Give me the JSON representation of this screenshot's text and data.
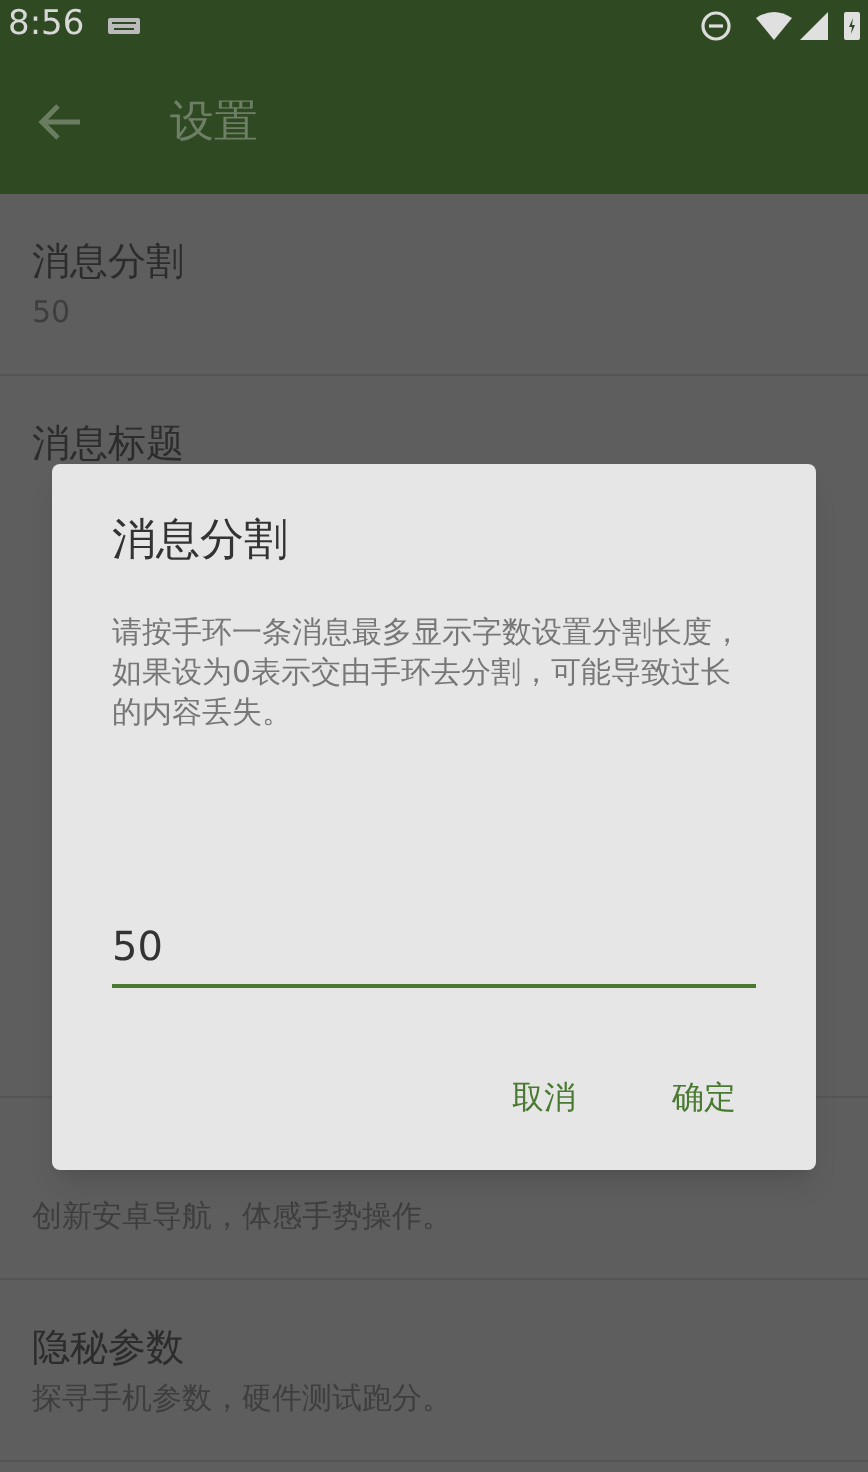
{
  "status_bar": {
    "time": "8:56"
  },
  "toolbar": {
    "title": "设置"
  },
  "settings": [
    {
      "kind": "pref",
      "title": "消息分割",
      "summary": "50"
    },
    {
      "kind": "pref",
      "title": "消息标题"
    },
    {
      "kind": "pref",
      "summary": "创新安卓导航，体感手势操作。"
    },
    {
      "kind": "pref",
      "title": "隐秘参数",
      "summary": "探寻手机参数，硬件测试跑分。"
    }
  ],
  "dialog": {
    "title": "消息分割",
    "message": "请按手环一条消息最多显示字数设置分割长度，如果设为0表示交由手环去分割，可能导致过长的内容丢失。",
    "value": "50",
    "buttons": [
      "取消",
      "确定"
    ]
  }
}
